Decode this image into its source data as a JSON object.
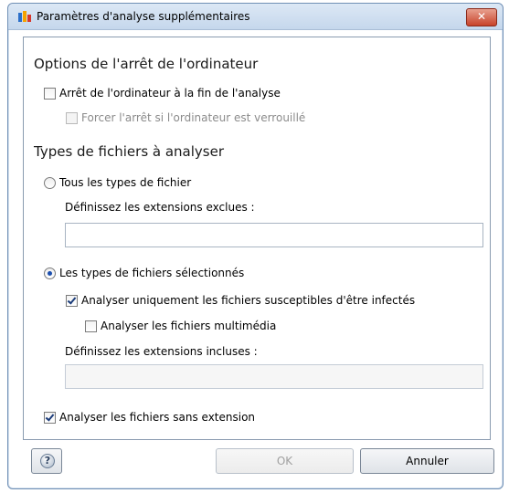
{
  "window": {
    "title": "Paramètres d'analyse supplémentaires",
    "close_label": "✕"
  },
  "shutdown": {
    "heading": "Options de l'arrêt de l'ordinateur",
    "shutdown_label": "Arrêt de l'ordinateur à la fin de l'analyse",
    "shutdown_checked": false,
    "force_label": "Forcer l'arrêt si l'ordinateur est verrouillé",
    "force_checked": false,
    "force_disabled": true
  },
  "file_types": {
    "heading": "Types de fichiers à analyser",
    "all_types_label": "Tous les types de fichier",
    "all_types_selected": false,
    "excluded_label": "Définissez les extensions exclues :",
    "excluded_value": "",
    "selected_types_label": "Les types de fichiers sélectionnés",
    "selected_types_selected": true,
    "infectable_label": "Analyser uniquement les fichiers susceptibles d'être infectés",
    "infectable_checked": true,
    "multimedia_label": "Analyser les fichiers multimédia",
    "multimedia_checked": false,
    "included_label": "Définissez les extensions incluses :",
    "included_value": "",
    "no_extension_label": "Analyser les fichiers sans extension",
    "no_extension_checked": true
  },
  "buttons": {
    "help_label": "?",
    "ok_label": "OK",
    "cancel_label": "Annuler"
  },
  "colors": {
    "accent": "#1c4fae",
    "close": "#c8432a",
    "title_bar": "#c5d7ec"
  }
}
